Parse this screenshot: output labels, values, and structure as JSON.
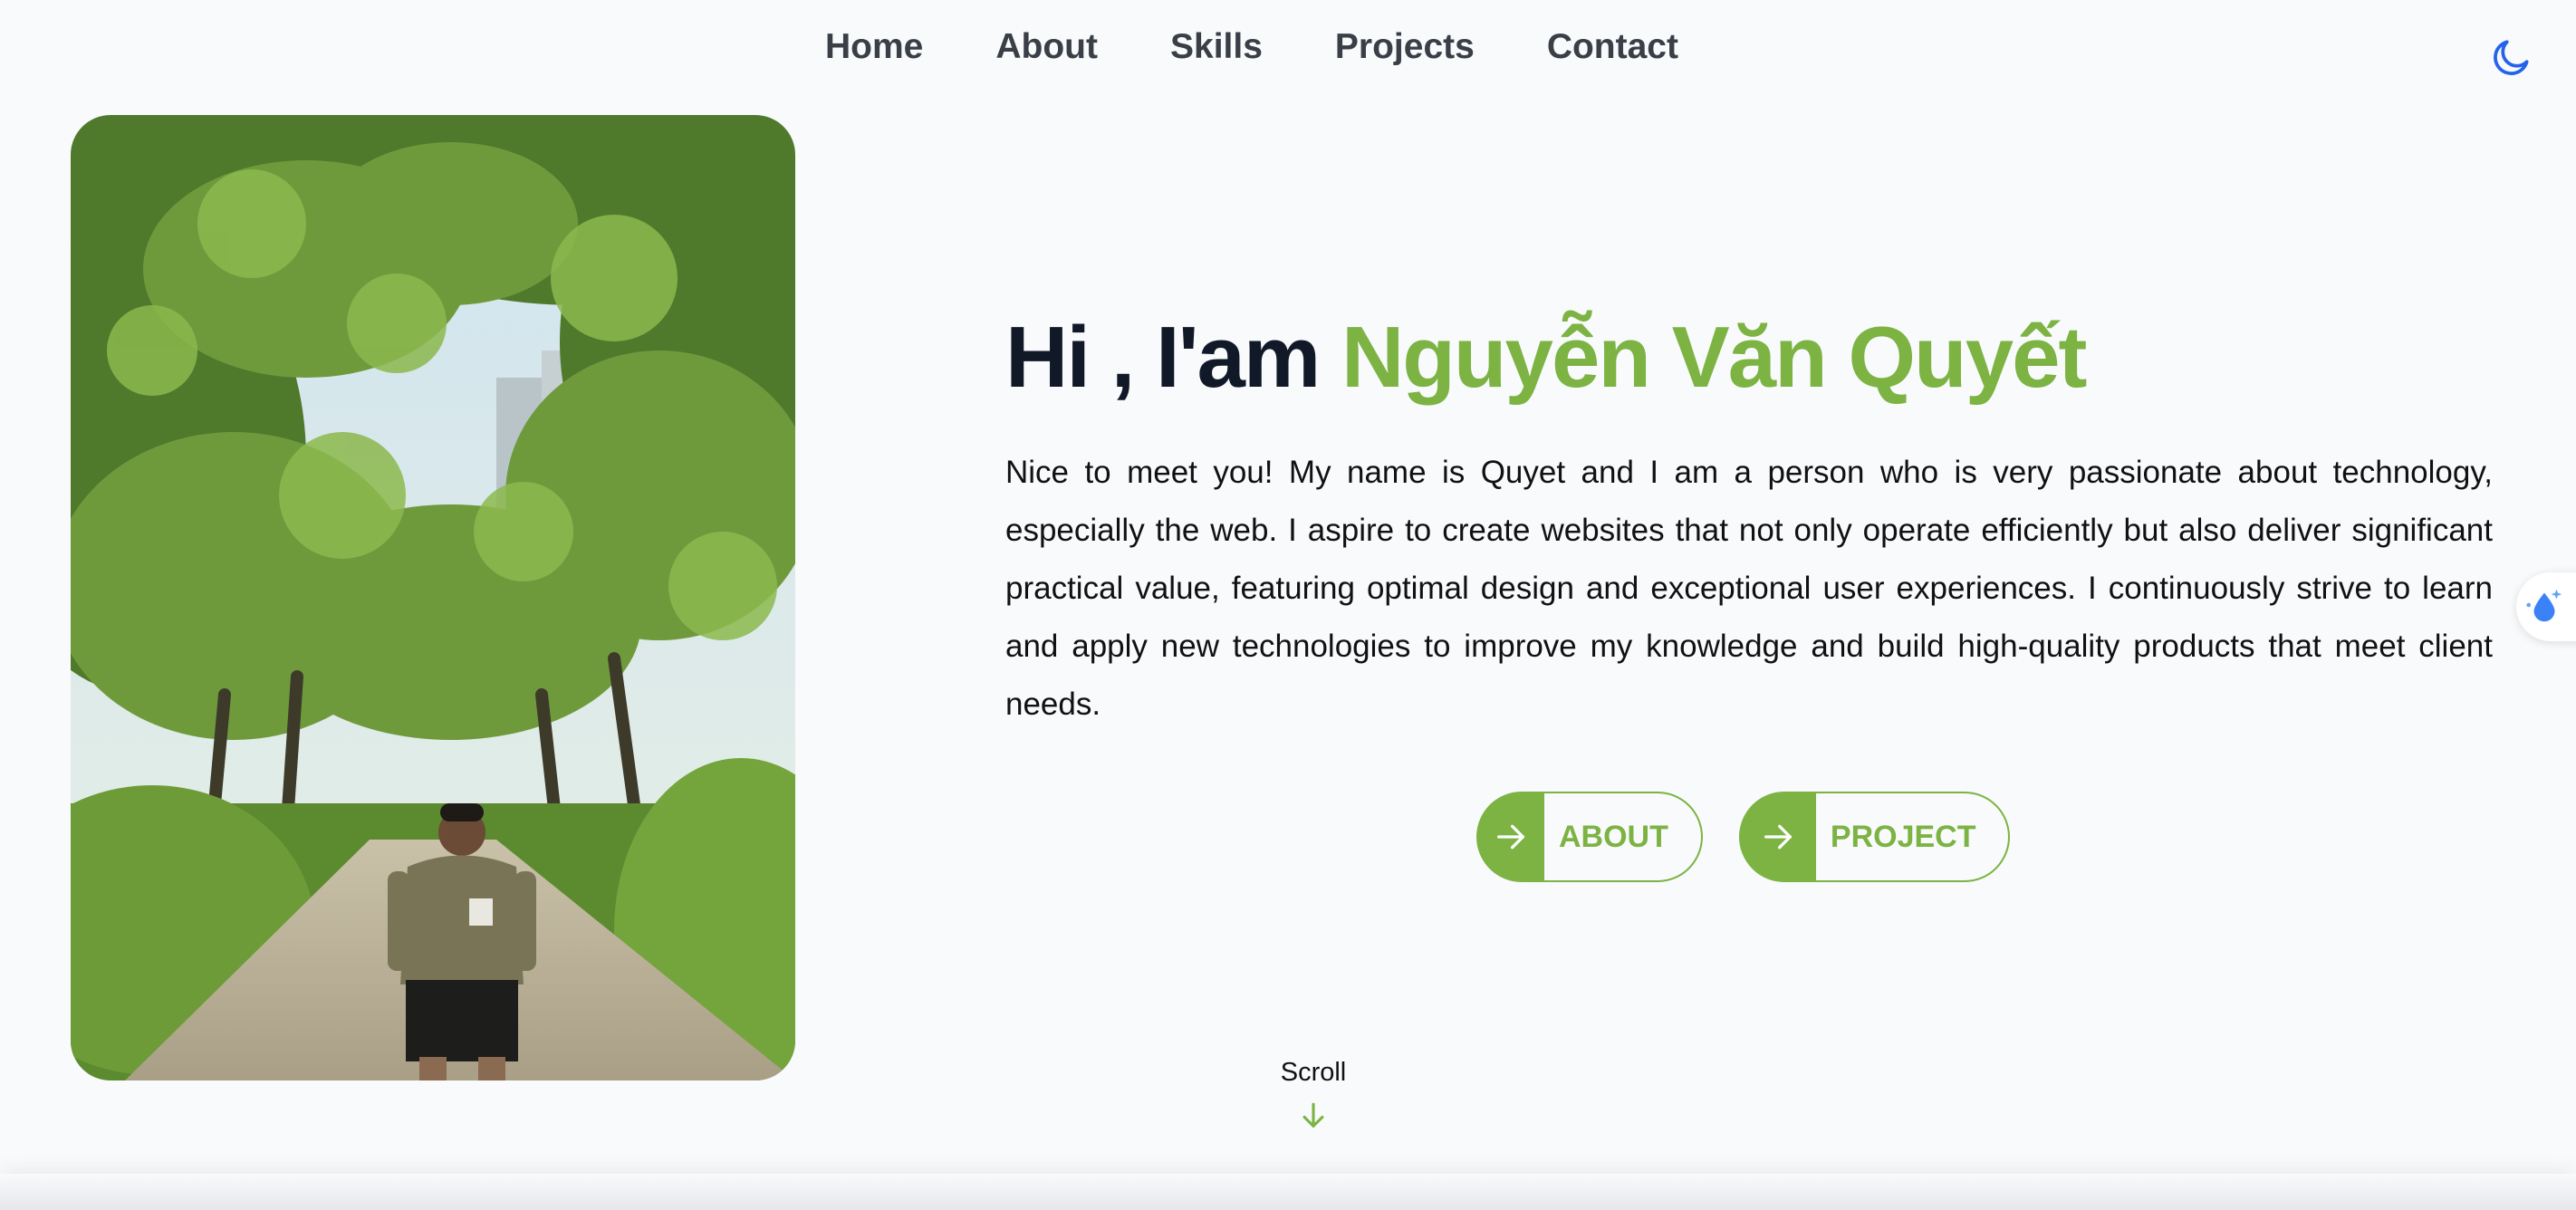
{
  "nav": {
    "items": [
      {
        "label": "Home"
      },
      {
        "label": "About"
      },
      {
        "label": "Skills"
      },
      {
        "label": "Projects"
      },
      {
        "label": "Contact"
      }
    ],
    "theme_icon": "moon-icon"
  },
  "hero": {
    "greeting": "Hi , I'am",
    "name": "Nguyễn Văn Quyết",
    "intro": "Nice to meet you! My name is Quyet and I am a person who is very passionate about technology, especially the web. I aspire to create websites that not only operate efficiently but also deliver significant practical value, featuring optimal design and exceptional user experiences. I continuously strive to learn and apply new technologies to improve my knowledge and build high-quality products that meet client needs.",
    "buttons": [
      {
        "label": "ABOUT",
        "icon": "arrow-right-icon"
      },
      {
        "label": "PROJECT",
        "icon": "arrow-right-icon"
      }
    ]
  },
  "scroll": {
    "label": "Scroll",
    "icon": "arrow-down-icon"
  },
  "colors": {
    "accent": "#7cb342",
    "background": "#f8fafc",
    "theme_icon": "#2563eb"
  }
}
